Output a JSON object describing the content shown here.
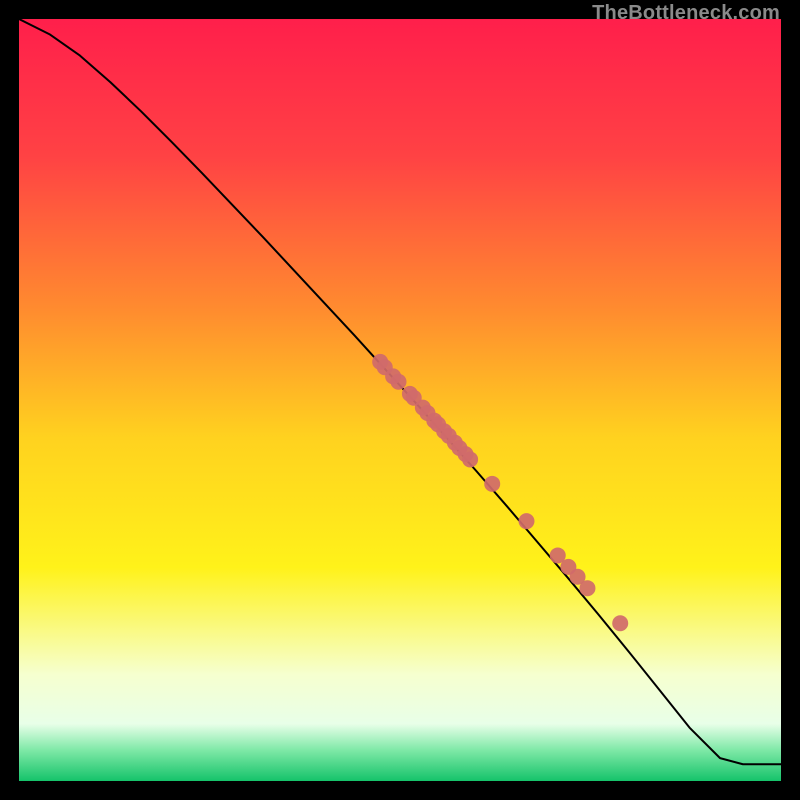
{
  "watermark": "TheBottleneck.com",
  "chart_data": {
    "type": "line",
    "title": "",
    "xlabel": "",
    "ylabel": "",
    "xlim": [
      0,
      100
    ],
    "ylim": [
      0,
      100
    ],
    "grid": false,
    "legend": false,
    "background": {
      "type": "vertical-gradient",
      "stops": [
        {
          "pos": 0,
          "color": "#ff1f4b"
        },
        {
          "pos": 0.18,
          "color": "#ff4244"
        },
        {
          "pos": 0.38,
          "color": "#ff8b2f"
        },
        {
          "pos": 0.55,
          "color": "#ffd21f"
        },
        {
          "pos": 0.72,
          "color": "#fff21a"
        },
        {
          "pos": 0.86,
          "color": "#f6ffcf"
        },
        {
          "pos": 0.925,
          "color": "#e8ffe8"
        },
        {
          "pos": 0.96,
          "color": "#7de8a6"
        },
        {
          "pos": 1.0,
          "color": "#15c36a"
        }
      ]
    },
    "series": [
      {
        "name": "curve",
        "color": "#000000",
        "x": [
          0,
          4,
          8,
          12,
          16,
          20,
          24,
          28,
          32,
          36,
          40,
          44,
          48,
          52,
          56,
          60,
          64,
          68,
          72,
          76,
          80,
          84,
          88,
          92,
          95,
          100
        ],
        "y": [
          100.0,
          98.0,
          95.2,
          91.7,
          87.9,
          83.9,
          79.8,
          75.6,
          71.4,
          67.1,
          62.8,
          58.5,
          54.1,
          49.7,
          45.2,
          40.7,
          36.1,
          31.4,
          26.7,
          21.9,
          17.0,
          12.0,
          7.0,
          3.0,
          2.2,
          2.2
        ]
      }
    ],
    "markers": {
      "name": "points",
      "color": "#d06a6a",
      "radius_px": 8,
      "x": [
        47.4,
        48.0,
        49.1,
        49.8,
        51.3,
        51.8,
        53.0,
        53.6,
        54.5,
        55.0,
        55.8,
        56.4,
        57.2,
        57.8,
        58.6,
        59.2,
        62.1,
        66.6,
        70.7,
        72.1,
        73.3,
        74.6,
        78.9
      ],
      "y": [
        55.0,
        54.3,
        53.1,
        52.4,
        50.8,
        50.3,
        49.0,
        48.3,
        47.3,
        46.8,
        45.9,
        45.3,
        44.4,
        43.7,
        42.9,
        42.2,
        39.0,
        34.1,
        29.6,
        28.1,
        26.8,
        25.3,
        20.7
      ]
    }
  }
}
